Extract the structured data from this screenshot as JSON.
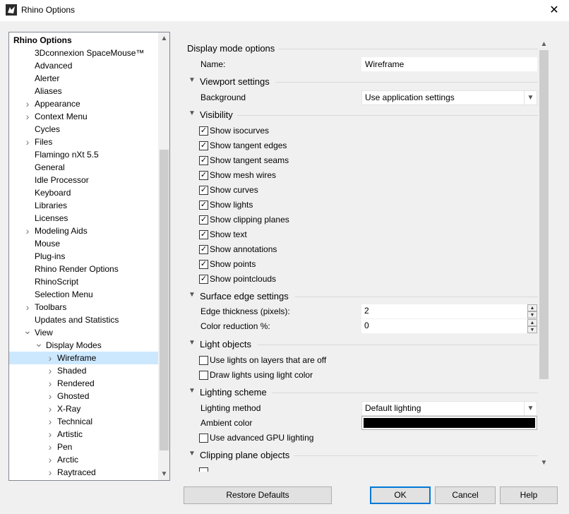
{
  "window": {
    "title": "Rhino Options",
    "icon": "rhino-icon"
  },
  "tree": {
    "items": [
      {
        "label": "Rhino Options",
        "level": 0,
        "expander": "none",
        "bold": true
      },
      {
        "label": "3Dconnexion SpaceMouse™",
        "level": 1,
        "expander": "none"
      },
      {
        "label": "Advanced",
        "level": 1,
        "expander": "none"
      },
      {
        "label": "Alerter",
        "level": 1,
        "expander": "none"
      },
      {
        "label": "Aliases",
        "level": 1,
        "expander": "none"
      },
      {
        "label": "Appearance",
        "level": 1,
        "expander": "collapsed"
      },
      {
        "label": "Context Menu",
        "level": 1,
        "expander": "collapsed"
      },
      {
        "label": "Cycles",
        "level": 1,
        "expander": "none"
      },
      {
        "label": "Files",
        "level": 1,
        "expander": "collapsed"
      },
      {
        "label": "Flamingo nXt 5.5",
        "level": 1,
        "expander": "none"
      },
      {
        "label": "General",
        "level": 1,
        "expander": "none"
      },
      {
        "label": "Idle Processor",
        "level": 1,
        "expander": "none"
      },
      {
        "label": "Keyboard",
        "level": 1,
        "expander": "none"
      },
      {
        "label": "Libraries",
        "level": 1,
        "expander": "none"
      },
      {
        "label": "Licenses",
        "level": 1,
        "expander": "none"
      },
      {
        "label": "Modeling Aids",
        "level": 1,
        "expander": "collapsed"
      },
      {
        "label": "Mouse",
        "level": 1,
        "expander": "none"
      },
      {
        "label": "Plug-ins",
        "level": 1,
        "expander": "none"
      },
      {
        "label": "Rhino Render Options",
        "level": 1,
        "expander": "none"
      },
      {
        "label": "RhinoScript",
        "level": 1,
        "expander": "none"
      },
      {
        "label": "Selection Menu",
        "level": 1,
        "expander": "none"
      },
      {
        "label": "Toolbars",
        "level": 1,
        "expander": "collapsed"
      },
      {
        "label": "Updates and Statistics",
        "level": 1,
        "expander": "none"
      },
      {
        "label": "View",
        "level": 1,
        "expander": "expanded"
      },
      {
        "label": "Display Modes",
        "level": 2,
        "expander": "expanded"
      },
      {
        "label": "Wireframe",
        "level": 3,
        "expander": "collapsed",
        "selected": true
      },
      {
        "label": "Shaded",
        "level": 3,
        "expander": "collapsed"
      },
      {
        "label": "Rendered",
        "level": 3,
        "expander": "collapsed"
      },
      {
        "label": "Ghosted",
        "level": 3,
        "expander": "collapsed"
      },
      {
        "label": "X-Ray",
        "level": 3,
        "expander": "collapsed"
      },
      {
        "label": "Technical",
        "level": 3,
        "expander": "collapsed"
      },
      {
        "label": "Artistic",
        "level": 3,
        "expander": "collapsed"
      },
      {
        "label": "Pen",
        "level": 3,
        "expander": "collapsed"
      },
      {
        "label": "Arctic",
        "level": 3,
        "expander": "collapsed"
      },
      {
        "label": "Raytraced",
        "level": 3,
        "expander": "collapsed"
      }
    ]
  },
  "options": {
    "display_mode_title": "Display mode options",
    "name_label": "Name:",
    "name_value": "Wireframe",
    "viewport": {
      "title": "Viewport settings",
      "background_label": "Background",
      "background_value": "Use application settings"
    },
    "visibility": {
      "title": "Visibility",
      "items": [
        {
          "label": "Show isocurves",
          "checked": true
        },
        {
          "label": "Show tangent edges",
          "checked": true
        },
        {
          "label": "Show tangent seams",
          "checked": true
        },
        {
          "label": "Show mesh wires",
          "checked": true
        },
        {
          "label": "Show curves",
          "checked": true
        },
        {
          "label": "Show lights",
          "checked": true
        },
        {
          "label": "Show clipping planes",
          "checked": true
        },
        {
          "label": "Show text",
          "checked": true
        },
        {
          "label": "Show annotations",
          "checked": true
        },
        {
          "label": "Show points",
          "checked": true
        },
        {
          "label": "Show pointclouds",
          "checked": true
        }
      ]
    },
    "surface_edge": {
      "title": "Surface edge settings",
      "thickness_label": "Edge thickness (pixels):",
      "thickness_value": "2",
      "color_reduction_label": "Color reduction %:",
      "color_reduction_value": "0"
    },
    "light_objects": {
      "title": "Light objects",
      "items": [
        {
          "label": "Use lights on layers that are off",
          "checked": false
        },
        {
          "label": "Draw lights using light color",
          "checked": false
        }
      ]
    },
    "lighting_scheme": {
      "title": "Lighting scheme",
      "method_label": "Lighting method",
      "method_value": "Default lighting",
      "ambient_label": "Ambient color",
      "ambient_color": "#000000",
      "gpu_label": "Use advanced GPU lighting",
      "gpu_checked": false
    },
    "clipping": {
      "title": "Clipping plane objects"
    }
  },
  "buttons": {
    "restore": "Restore Defaults",
    "ok": "OK",
    "cancel": "Cancel",
    "help": "Help"
  }
}
